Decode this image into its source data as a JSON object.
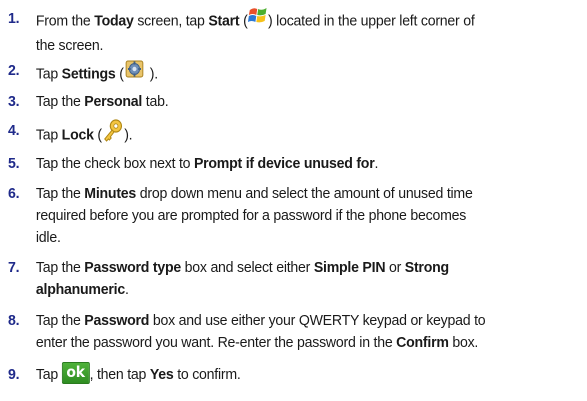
{
  "steps": [
    {
      "num": "1.",
      "l1a": "From the ",
      "l1b": "Today",
      "l1c": " screen, tap ",
      "l1d": "Start",
      "l1e": " (",
      "l1f": ") located in the upper left corner of",
      "l2": "the screen."
    },
    {
      "num": "2.",
      "a": "Tap ",
      "b": "Settings",
      "c": " (",
      "d": " )."
    },
    {
      "num": "3.",
      "a": "Tap the ",
      "b": "Personal",
      "c": " tab."
    },
    {
      "num": "4.",
      "a": "Tap ",
      "b": "Lock",
      "c": " (",
      "d": ")."
    },
    {
      "num": "5.",
      "a": "Tap the check box next to ",
      "b": "Prompt if device unused for",
      "c": "."
    },
    {
      "num": "6.",
      "l1a": "Tap the ",
      "l1b": "Minutes",
      "l1c": " drop down menu and select the amount of unused time",
      "l2": "required before you are prompted for a password if the phone becomes",
      "l3": "idle."
    },
    {
      "num": "7.",
      "l1a": "Tap the ",
      "l1b": "Password type",
      "l1c": " box and select either ",
      "l1d": "Simple PIN",
      "l1e": " or ",
      "l1f": "Strong",
      "l2": "alphanumeric",
      "l2b": "."
    },
    {
      "num": "8.",
      "l1a": "Tap the ",
      "l1b": "Password",
      "l1c": " box and use either your QWERTY keypad or keypad to",
      "l2a": "enter the password you want. Re-enter the password in the ",
      "l2b": "Confirm",
      "l2c": " box."
    },
    {
      "num": "9.",
      "a": "Tap ",
      "ok": "ok",
      "b": ", then tap ",
      "c": "Yes",
      "d": " to confirm."
    }
  ],
  "icons": {
    "start": "windows-flag-icon",
    "settings": "settings-gear-icon",
    "lock": "key-icon"
  },
  "colors": {
    "number": "#1f2a8a",
    "ok_button": "#3a9e2b"
  }
}
